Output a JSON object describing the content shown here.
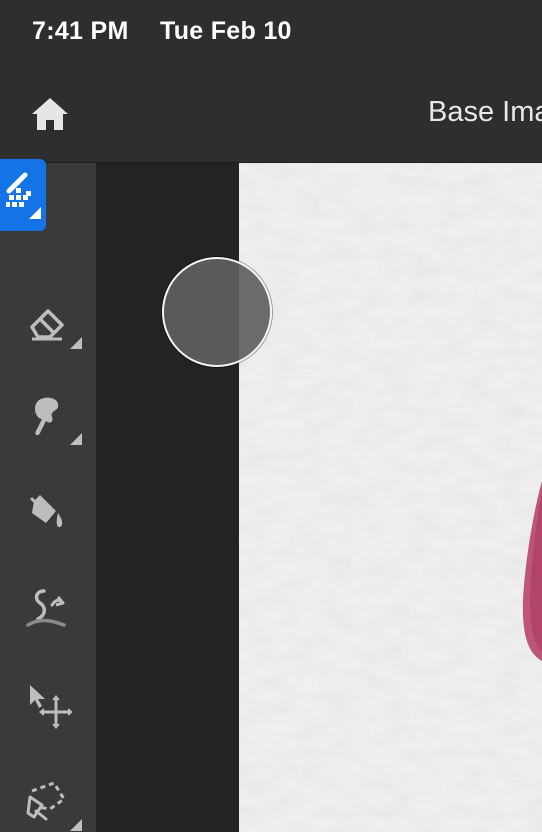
{
  "status_bar": {
    "time": "7:41 PM",
    "date": "Tue Feb 10"
  },
  "header": {
    "home_icon": "home-icon",
    "document_title": "Base Ima"
  },
  "toolbar": {
    "tools": [
      {
        "name": "quick-selection-tool",
        "icon": "quick-selection-icon",
        "active": true,
        "has_submenu": true
      },
      {
        "name": "eraser-tool",
        "icon": "eraser-icon",
        "active": false,
        "has_submenu": true
      },
      {
        "name": "smudge-tool",
        "icon": "smudge-icon",
        "active": false,
        "has_submenu": true
      },
      {
        "name": "paint-bucket-tool",
        "icon": "paint-bucket-icon",
        "active": false,
        "has_submenu": false
      },
      {
        "name": "liquify-tool",
        "icon": "liquify-icon",
        "active": false,
        "has_submenu": false
      },
      {
        "name": "move-tool",
        "icon": "move-icon",
        "active": false,
        "has_submenu": false
      },
      {
        "name": "lasso-tool",
        "icon": "lasso-icon",
        "active": false,
        "has_submenu": true
      }
    ]
  },
  "colors": {
    "accent": "#1473e6",
    "toolbar_bg": "#3a3a3a",
    "panel_bg": "#232323",
    "canvas_bg": "#f1f1f1",
    "paint_stroke": "#b8456e"
  },
  "brush_cursor": {
    "icon": "brush-cursor"
  }
}
